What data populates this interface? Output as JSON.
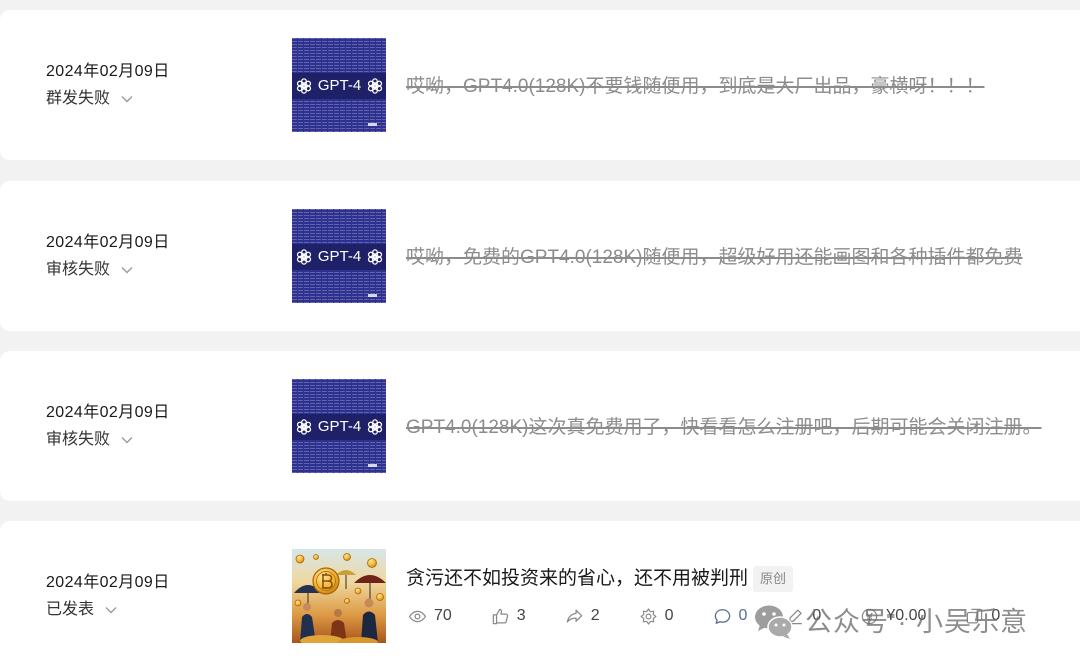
{
  "articles": [
    {
      "date": "2024年02月09日",
      "status": "群发失败",
      "title": "哎呦，GPT4.0(128K)不要钱随便用，到底是大厂出品，豪横呀！！！",
      "cover_text": "GPT-4"
    },
    {
      "date": "2024年02月09日",
      "status": "审核失败",
      "title": "哎呦，免费的GPT4.0(128K)随便用，超级好用还能画图和各种插件都免费",
      "cover_text": "GPT-4"
    },
    {
      "date": "2024年02月09日",
      "status": "审核失败",
      "title": "GPT4.0(128K)这次真免费用了，快看看怎么注册吧，后期可能会关闭注册。",
      "cover_text": "GPT-4"
    },
    {
      "date": "2024年02月09日",
      "status": "已发表",
      "title": "贪污还不如投资来的省心，还不用被判刑",
      "badge": "原创",
      "stats": [
        {
          "icon": "eye-icon",
          "value": "70"
        },
        {
          "icon": "thumbs-up-icon",
          "value": "3"
        },
        {
          "icon": "share-icon",
          "value": "2"
        },
        {
          "icon": "wow-icon",
          "value": "0"
        },
        {
          "icon": "comment-icon",
          "value": "0"
        },
        {
          "icon": "underline-icon",
          "value": "0"
        },
        {
          "icon": "reward-icon",
          "value": "¥0.00"
        },
        {
          "icon": "repost-icon",
          "value": "0"
        }
      ]
    }
  ],
  "icons": {
    "status_toggle": "chevron-down-icon",
    "cover_logo": "openai-logo-icon"
  },
  "watermark": {
    "logo": "wechat-logo-icon",
    "text": "公众号 · 小吴乐意"
  },
  "colors": {
    "page_bg": "#f2f2f2",
    "card_bg": "#ffffff",
    "text": "#1a1a1a",
    "muted": "#8c8c8c",
    "link": "#576b95",
    "cover_blue": "#2f318e"
  }
}
